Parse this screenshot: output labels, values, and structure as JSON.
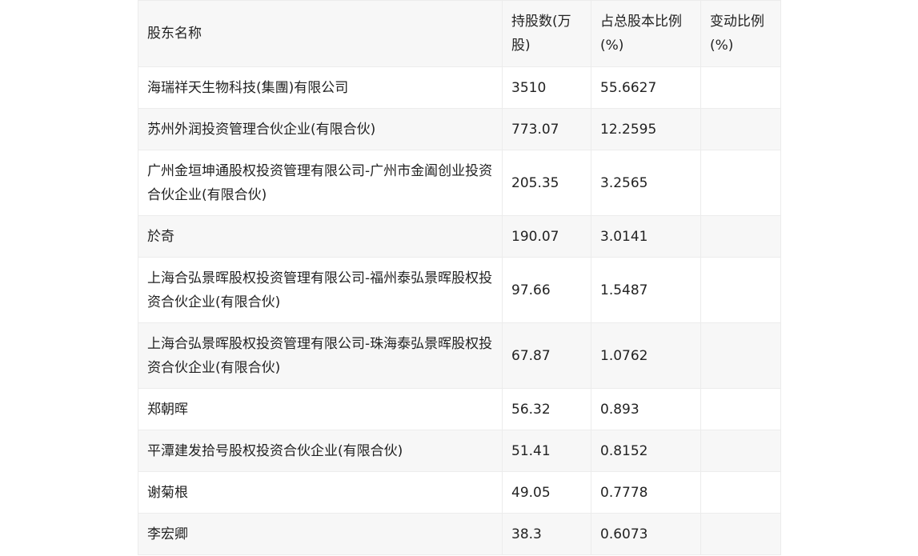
{
  "table": {
    "headers": [
      "股东名称",
      "持股数(万股)",
      "占总股本比例(%)",
      "变动比例(%)"
    ],
    "rows": [
      [
        "海瑞祥天生物科技(集團)有限公司",
        "3510",
        "55.6627",
        ""
      ],
      [
        "苏州外润投资管理合伙企业(有限合伙)",
        "773.07",
        "12.2595",
        ""
      ],
      [
        "广州金垣坤通股权投资管理有限公司-广州市金阖创业投资合伙企业(有限合伙)",
        "205.35",
        "3.2565",
        ""
      ],
      [
        "於奇",
        "190.07",
        "3.0141",
        ""
      ],
      [
        "上海合弘景晖股权投资管理有限公司-福州泰弘景晖股权投资合伙企业(有限合伙)",
        "97.66",
        "1.5487",
        ""
      ],
      [
        "上海合弘景晖股权投资管理有限公司-珠海泰弘景晖股权投资合伙企业(有限合伙)",
        "67.87",
        "1.0762",
        ""
      ],
      [
        "郑朝晖",
        "56.32",
        "0.893",
        ""
      ],
      [
        "平潭建发拾号股权投资合伙企业(有限合伙)",
        "51.41",
        "0.8152",
        ""
      ],
      [
        "谢菊根",
        "49.05",
        "0.7778",
        ""
      ],
      [
        "李宏卿",
        "38.3",
        "0.6073",
        ""
      ]
    ]
  }
}
